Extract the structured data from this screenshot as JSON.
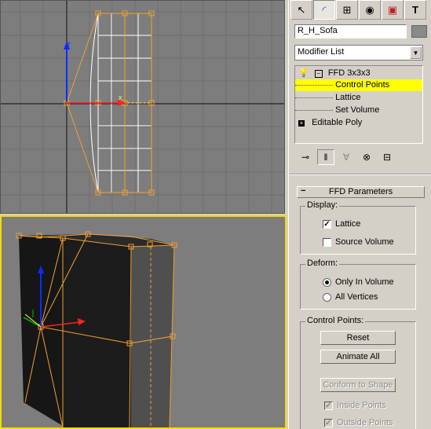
{
  "viewports": {
    "front_axis_z": "z",
    "front_axis_x": "x"
  },
  "command_panel": {
    "tabs": [
      {
        "name": "create-tab",
        "glyph": "↖"
      },
      {
        "name": "modify-tab",
        "glyph": "◜"
      },
      {
        "name": "hierarchy-tab",
        "glyph": "⊞"
      },
      {
        "name": "motion-tab",
        "glyph": "◉"
      },
      {
        "name": "display-tab",
        "glyph": "▣"
      },
      {
        "name": "utilities-tab",
        "glyph": "T"
      }
    ],
    "object_name": "R_H_Sofa",
    "object_color": "#8a8a8a",
    "modifier_list": "Modifier List",
    "stack": {
      "ffd": "FFD 3x3x3",
      "control_points": "Control Points",
      "lattice": "Lattice",
      "set_volume": "Set Volume",
      "editable_poly": "Editable Poly"
    },
    "ffd_parameters": {
      "title": "FFD Parameters",
      "display_label": "Display:",
      "lattice_label": "Lattice",
      "lattice_checked": true,
      "source_volume_label": "Source Volume",
      "source_volume_checked": false,
      "deform_label": "Deform:",
      "only_in_volume_label": "Only In Volume",
      "all_vertices_label": "All Vertices",
      "deform_selected": "Only In Volume",
      "control_points_label": "Control Points:",
      "reset_label": "Reset",
      "animate_all_label": "Animate All",
      "conform_label": "Conform to Shape",
      "inside_points_label": "Inside Points",
      "outside_points_label": "Outside Points"
    },
    "selection_color": "#ffff00",
    "viewport_active_color": "#f7d800"
  }
}
